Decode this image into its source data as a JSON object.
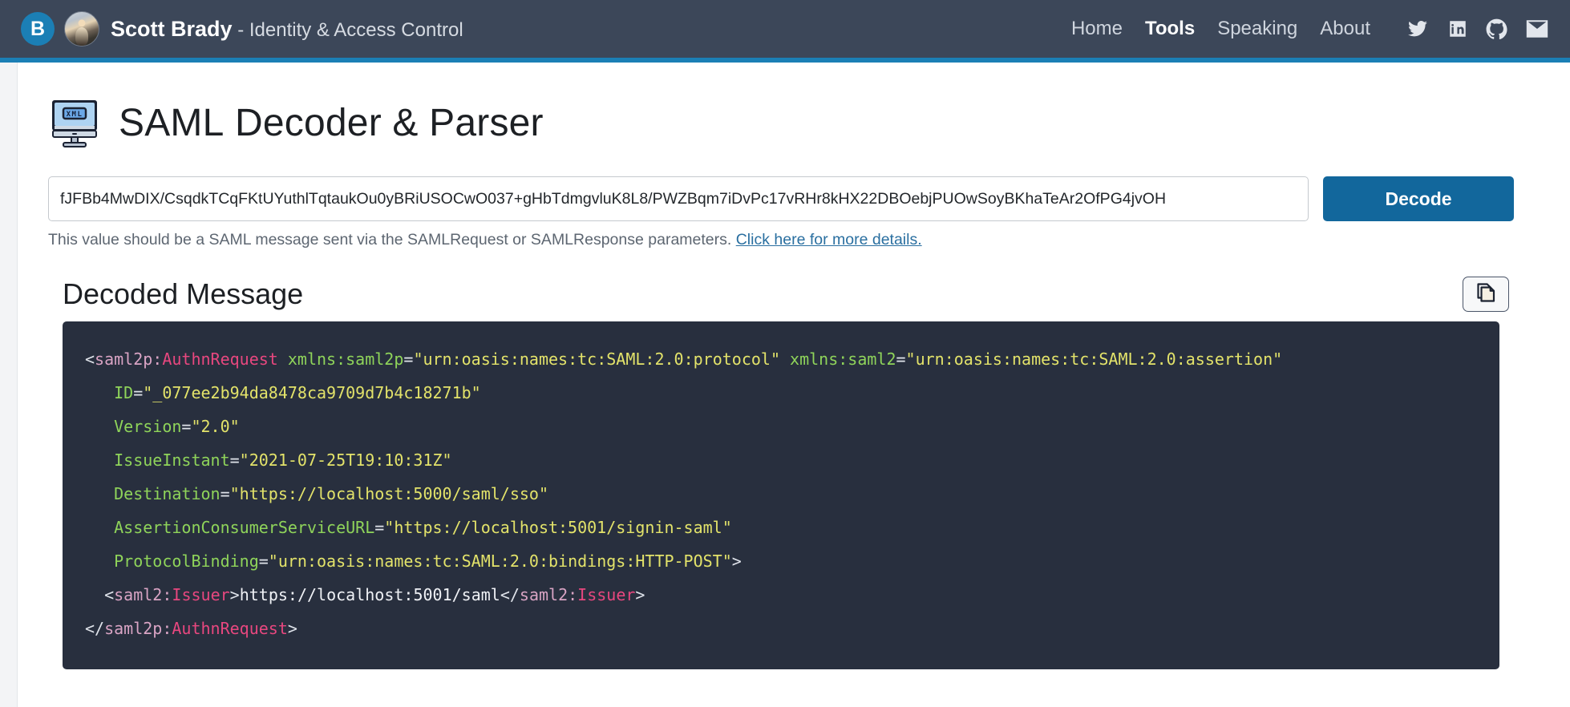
{
  "header": {
    "logo_letter": "B",
    "brand_name": "Scott Brady",
    "brand_tagline": " - Identity & Access Control",
    "nav": [
      {
        "label": "Home",
        "active": false
      },
      {
        "label": "Tools",
        "active": true
      },
      {
        "label": "Speaking",
        "active": false
      },
      {
        "label": "About",
        "active": false
      }
    ],
    "social": [
      {
        "name": "twitter-icon"
      },
      {
        "name": "linkedin-icon"
      },
      {
        "name": "github-icon"
      },
      {
        "name": "email-icon"
      }
    ],
    "accent_color": "#1b7fb5",
    "background_color": "#3c4759"
  },
  "page": {
    "icon_name": "xml-monitor-icon",
    "icon_label": "XML",
    "title_strong": "SAML",
    "title_rest": " Decoder & Parser"
  },
  "form": {
    "input_value": "fJFBb4MwDIX/CsqdkTCqFKtUYuthlTqtaukOu0yBRiUSOCwO037+gHbTdmgvluK8L8/PWZBqm7iDvPc17vRHr8kHX22DBOebjPUOwSoyBKhaTeAr2OfPG4jvOH",
    "input_placeholder": "",
    "decode_label": "Decode",
    "help_text": "This value should be a SAML message sent via the SAMLRequest or SAMLResponse parameters. ",
    "help_link": "Click here for more details."
  },
  "result": {
    "heading": "Decoded Message",
    "copy_icon": "copy-icon",
    "xml": {
      "line1": {
        "open": "<",
        "tag_ns": "saml2p",
        "tag_sep": ":",
        "tag_name": "AuthnRequest",
        "attr1": "xmlns:saml2p",
        "attr1_value": "\"urn:oasis:names:tc:SAML:2.0:protocol\"",
        "attr2": "xmlns:saml2",
        "attr2_value": "\"urn:oasis:names:tc:SAML:2.0:assertion\""
      },
      "attrs": [
        {
          "name": "ID",
          "value": "\"_077ee2b94da8478ca9709d7b4c18271b\""
        },
        {
          "name": "Version",
          "value": "\"2.0\""
        },
        {
          "name": "IssueInstant",
          "value": "\"2021-07-25T19:10:31Z\""
        },
        {
          "name": "Destination",
          "value": "\"https://localhost:5000/saml/sso\""
        },
        {
          "name": "AssertionConsumerServiceURL",
          "value": "\"https://localhost:5001/signin-saml\""
        },
        {
          "name": "ProtocolBinding",
          "value": "\"urn:oasis:names:tc:SAML:2.0:bindings:HTTP-POST\""
        }
      ],
      "open_tag_close": ">",
      "issuer": {
        "open": "<",
        "ns": "saml2",
        "sep": ":",
        "name": "Issuer",
        "gt": ">",
        "text": "https://localhost:5001/saml",
        "close_open": "</",
        "close_ns": "saml2",
        "close_sep": ":",
        "close_name": "Issuer",
        "close_gt": ">"
      },
      "close": {
        "open": "</",
        "ns": "saml2p",
        "sep": ":",
        "name": "AuthnRequest",
        "gt": ">"
      }
    },
    "colors": {
      "background": "#282f3e",
      "tag": "#e8477f",
      "namespace": "#d9a4c4",
      "attribute": "#8fd45a",
      "value": "#e3e36a",
      "text": "#f0f2f6"
    }
  }
}
